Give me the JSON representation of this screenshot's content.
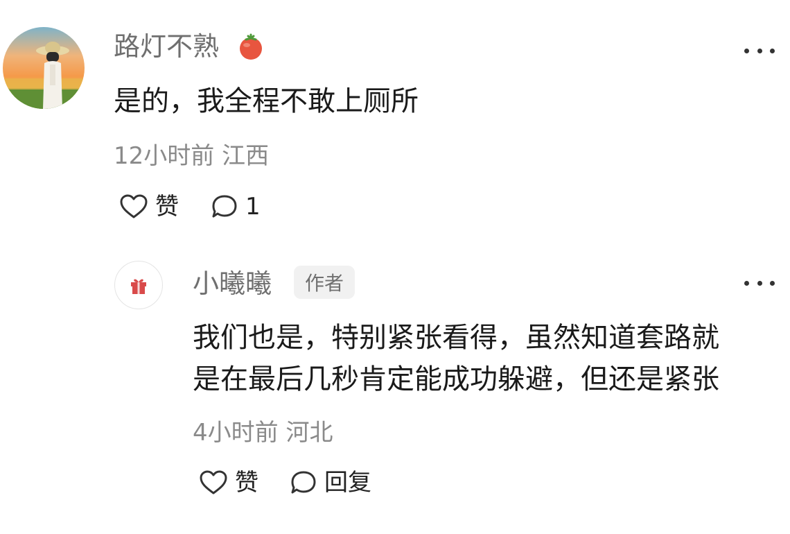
{
  "main_comment": {
    "username": "路灯不熟",
    "username_emoji": "tomato-icon",
    "text": "是的，我全程不敢上厕所",
    "meta": "12小时前 江西",
    "like_label": "赞",
    "reply_count": "1"
  },
  "reply": {
    "username": "小曦曦",
    "badge": "作者",
    "text_line1": "我们也是，特别紧张看得，虽然知道套路就",
    "text_line2": "是在最后几秒肯定能成功躲避，但还是紧张",
    "meta": "4小时前 河北",
    "like_label": "赞",
    "reply_label": "回复"
  },
  "colors": {
    "username": "#6f6f6f",
    "meta": "#8a8a8a",
    "text": "#1a1a1a",
    "badge_bg": "#f1f1f1",
    "gift_red": "#d94a4a"
  }
}
